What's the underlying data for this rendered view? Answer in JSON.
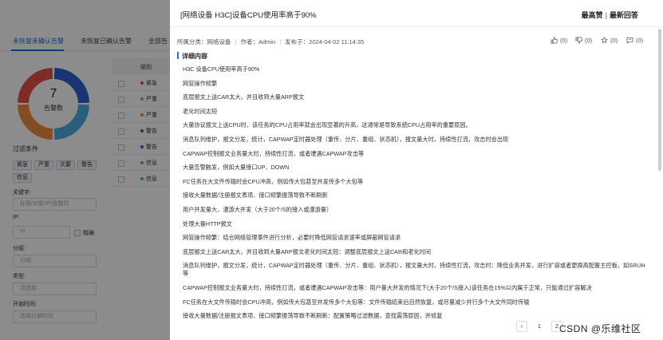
{
  "background": {
    "tabs": [
      {
        "label": "未恢复未确认告警"
      },
      {
        "label": "未恢复已确认告警"
      },
      {
        "label": "全部告"
      }
    ],
    "summary": {
      "count": "7",
      "label": "告警数"
    },
    "donut_segments": [
      {
        "color": "#2f5fd0",
        "value": 1
      },
      {
        "color": "#4fa9e6",
        "value": 1
      },
      {
        "color": "#f08a3c",
        "value": 1
      },
      {
        "color": "#e6514a",
        "value": 1
      }
    ],
    "filters": {
      "title": "过滤条件",
      "severities": [
        "紧急",
        "严重",
        "次要",
        "警告",
        "信息"
      ],
      "keyword_label": "关键字:",
      "keyword_placeholder": "标题/对象/IP/告警时",
      "ip_label": "IP:",
      "ip_placeholder": "IP",
      "exact_label": "精确",
      "group_label": "分组:",
      "group_placeholder": "分组",
      "type_label": "类型:",
      "type_placeholder": "请选择",
      "start_label": "开始时间:",
      "start_placeholder": "选择日期时间"
    },
    "table": {
      "header": "级别",
      "rows": [
        {
          "severity": "紧急",
          "color": "#e64a3c"
        },
        {
          "severity": "严重",
          "color": "#f08a3c"
        },
        {
          "severity": "严重",
          "color": "#f08a3c"
        },
        {
          "severity": "警告",
          "color": "#2f5fd0"
        },
        {
          "severity": "警告",
          "color": "#2f5fd0"
        },
        {
          "severity": "信息",
          "color": "#4fa9e6"
        },
        {
          "severity": "信息",
          "color": "#4fa9e6"
        }
      ]
    }
  },
  "drawer": {
    "title": "[网络设备 H3C]设备CPU使用率高于90%",
    "actions": {
      "top": "最高赞",
      "separator": "|",
      "latest": "最新回答"
    },
    "meta": {
      "category": "所属分类：网络设备",
      "author": "作者：Admin",
      "published": "发布于：2024-04-02 11:14:35"
    },
    "reactions": [
      {
        "icon": "thumbs-up-icon",
        "count": "(0)"
      },
      {
        "icon": "thumbs-down-icon",
        "count": "(0)"
      },
      {
        "icon": "star-icon",
        "count": "(0)"
      },
      {
        "icon": "comment-icon",
        "count": "(0)"
      }
    ],
    "section_title": "详细内容",
    "content": [
      "H3C 设备CPU使用率高于90%",
      "网管操作频繁",
      "底层报文上送CAR太大，并且收到大量ARP报文",
      "老化时间太短",
      "大量协议报文上送CPU时，该任务的CPU占用率就会出现显著的升高，这通常是导致系统CPU占用率的重要原因。",
      "消息队列维护，报文分发，统计，CAPWAP定时器处理（重传、分片、重组、状态机），报文量大时，持续性打流，攻击时会出现",
      "CAPWAP控制报文业务量大时，持续性打流，或者遭遇CAPWAP攻击等",
      "大量告警触发，例如大量接口UP、DOWN",
      "FC任务在大文件传输时会CPU冲高，例如传大包甚至并发传多个大包等",
      "接收大量数据/注册报文表项、接口频繁振荡导致不断刷新",
      "用户并发量大，漫游大并发（大于20个/S的接入或漫游量）",
      "处理大量HTTP报文",
      "网管操作频繁：结合网络管理事件进行分析，必要时降低网管请求速率或屏蔽网管请求",
      "底层报文上送CAR太大，并且收到大量ARP报文老化时间太短：调整底层报文上送CAR和老化时间",
      "消息队列维护，报文分发，统计，CAPWAP定时器处理（重传、分片、重组、状态机），报文量大时，持续性打流，攻击时：降低业务并发，进行扩容或者更换高配置主控板，如SRUH等",
      "CAPWAP控制报文业务量大时，持续性打流，或者遭遇CAPWAP攻击等：用户量大并发的情况下(大于20个/S接入)该任务在15%以内属于正常，只能通过扩容解决",
      "FC任务在大文件传输时会CPU冲高，例如传大包甚至并发传多个大包等：文件传输结束后自然恢复，或尽量减少并行多个大文件同时传输",
      "接收大量数据/注册报文表项、接口频繁振荡导致不断刷新：配置策略过滤数据，查找震荡原因，并修复"
    ],
    "pagination": {
      "prev": "‹",
      "pages": [
        "1",
        "2"
      ]
    },
    "watermark": "CSDN @乐维社区"
  }
}
